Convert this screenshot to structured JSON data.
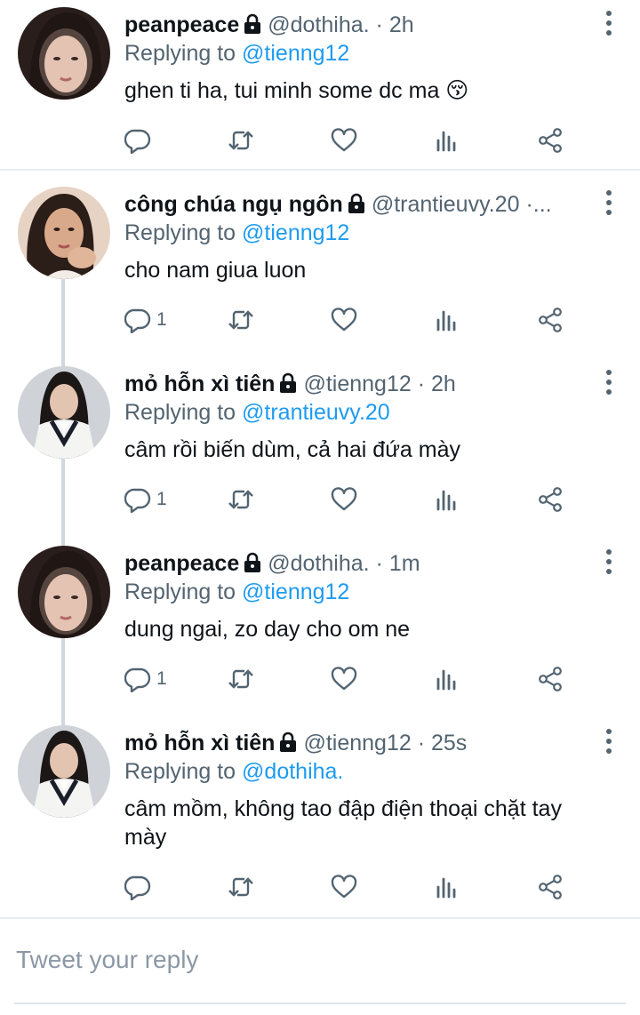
{
  "tweets": [
    {
      "name": "peanpeace",
      "handle": "@dothiha.",
      "time": "· 2h",
      "replying_label": "Replying to",
      "replying_to": "@tienng12",
      "text": "ghen ti ha, tui minh some dc ma 😚",
      "reply_count": ""
    },
    {
      "name": "công chúa ngụ ngôn",
      "handle": "@trantieuvy.20",
      "time": "·...",
      "replying_label": "Replying to",
      "replying_to": "@tienng12",
      "text": "cho nam giua luon",
      "reply_count": "1"
    },
    {
      "name": "mỏ hỗn xì tiên",
      "handle": "@tienng12",
      "time": "· 2h",
      "replying_label": "Replying to",
      "replying_to": "@trantieuvy.20",
      "text": "câm rồi biến dùm, cả hai đứa mày",
      "reply_count": "1"
    },
    {
      "name": "peanpeace",
      "handle": "@dothiha.",
      "time": "· 1m",
      "replying_label": "Replying to",
      "replying_to": "@tienng12",
      "text": "dung ngai, zo day cho om ne",
      "reply_count": "1"
    },
    {
      "name": "mỏ hỗn xì tiên",
      "handle": "@tienng12",
      "time": "· 25s",
      "replying_label": "Replying to",
      "replying_to": "@dothiha.",
      "text": "câm mồm, không tao đập điện thoại chặt tay mày",
      "reply_count": ""
    }
  ],
  "compose": {
    "placeholder": "Tweet your reply"
  },
  "colors": {
    "link": "#1d9bf0",
    "secondary": "#536471",
    "icon": "#536471",
    "thread_line": "#cfd9de"
  }
}
